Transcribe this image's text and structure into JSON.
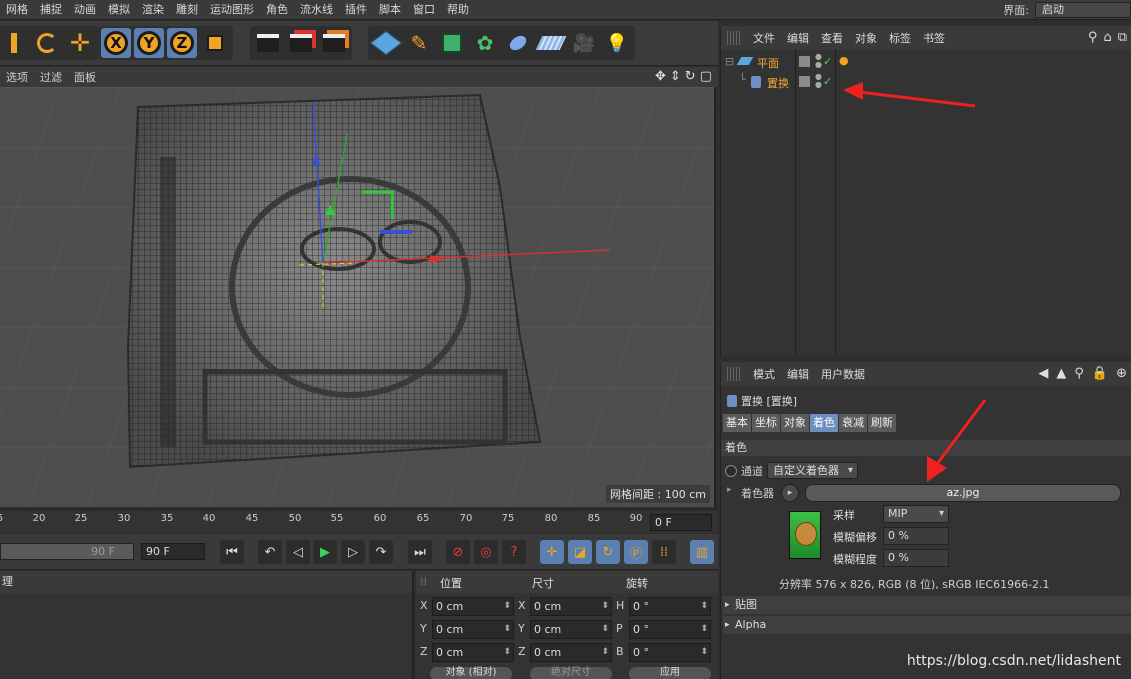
{
  "menu": {
    "items": [
      "网格",
      "捕捉",
      "动画",
      "模拟",
      "渲染",
      "雕刻",
      "运动图形",
      "角色",
      "流水线",
      "插件",
      "脚本",
      "窗口",
      "帮助"
    ],
    "layout_label": "界面:",
    "layout_value": "启动"
  },
  "viewport": {
    "menu": [
      "选项",
      "过滤",
      "面板"
    ],
    "grid_spacing": "网格间距 : 100 cm"
  },
  "timeline": {
    "ticks": [
      "5",
      "20",
      "25",
      "30",
      "35",
      "40",
      "45",
      "50",
      "55",
      "60",
      "65",
      "70",
      "75",
      "80",
      "85",
      "90"
    ],
    "current_frame": "0 F"
  },
  "transport": {
    "slider_value": "90 F",
    "end_frame": "90 F"
  },
  "material_panel": {
    "title": "理"
  },
  "coordinates": {
    "headers": {
      "position": "位置",
      "size": "尺寸",
      "rotation": "旋转"
    },
    "rows": [
      {
        "ax1": "X",
        "pos": "0 cm",
        "ax2": "X",
        "size": "0 cm",
        "ax3": "H",
        "rot": "0 °"
      },
      {
        "ax1": "Y",
        "pos": "0 cm",
        "ax2": "Y",
        "size": "0 cm",
        "ax3": "P",
        "rot": "0 °"
      },
      {
        "ax1": "Z",
        "pos": "0 cm",
        "ax2": "Z",
        "size": "0 cm",
        "ax3": "B",
        "rot": "0 °"
      }
    ],
    "mode_label": "对象 (相对)",
    "size_mode_label": "绝对尺寸",
    "apply_label": "应用"
  },
  "object_manager": {
    "menu": [
      "文件",
      "编辑",
      "查看",
      "对象",
      "标签",
      "书签"
    ],
    "objects": [
      {
        "name": "平面"
      },
      {
        "name": "置换"
      }
    ]
  },
  "attribute_manager": {
    "menu": [
      "模式",
      "编辑",
      "用户数据"
    ],
    "object_title": "置换 [置换]",
    "tabs": [
      "基本",
      "坐标",
      "对象",
      "着色",
      "衰减",
      "刷新"
    ],
    "active_tab": "着色",
    "section": "着色",
    "channel_label": "通道",
    "channel_value": "自定义着色器",
    "shader_label": "着色器",
    "shader_file": "az.jpg",
    "sampling_label": "采样",
    "sampling_value": "MIP",
    "blur_offset_label": "模糊偏移",
    "blur_offset_value": "0 %",
    "blur_scale_label": "模糊程度",
    "blur_scale_value": "0 %",
    "resolution_info": "分辨率 576 x 826, RGB (8 位), sRGB IEC61966-2.1",
    "groups": [
      "贴图",
      "Alpha"
    ]
  },
  "watermark": "https://blog.csdn.net/lidashent",
  "colors": {
    "accent": "#f0a422",
    "selection": "#6c8fc0",
    "object_name": "#f2a732"
  }
}
